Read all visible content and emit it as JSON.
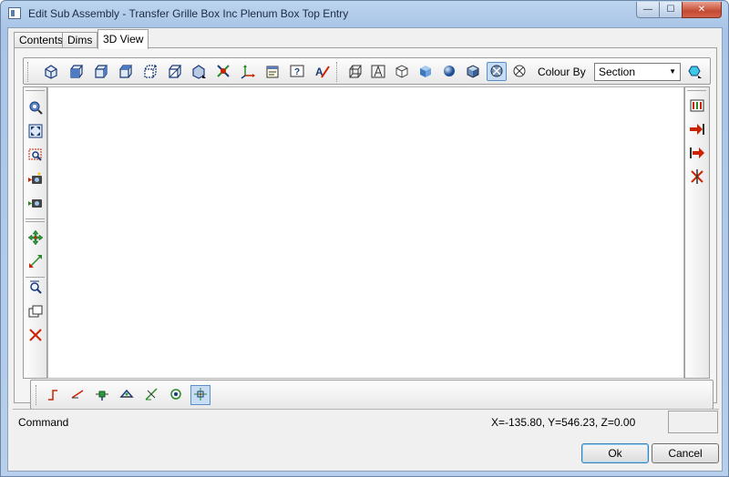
{
  "window": {
    "title": "Edit Sub Assembly - Transfer Grille Box Inc Plenum Box Top Entry",
    "controls": {
      "minimize": "—",
      "maximize": "☐",
      "close": "✕"
    }
  },
  "tabs": [
    {
      "label": "Contents"
    },
    {
      "label": "Dims"
    },
    {
      "label": "3D View"
    }
  ],
  "top_toolbar": {
    "view_icons": [
      "iso-view-icon",
      "front-view-icon",
      "back-view-icon",
      "left-view-icon",
      "right-view-icon",
      "top-view-icon",
      "bottom-view-icon",
      "axis-rotate-icon",
      "ucs-icon",
      "properties-icon",
      "help-icon",
      "text-edit-icon"
    ],
    "render_icons": [
      "wireframe-icon",
      "hidden-line-icon",
      "outline-icon",
      "shaded-icon",
      "sphere-shaded-icon",
      "solid-shaded-icon",
      "section-render-icon",
      "section-clear-icon"
    ],
    "selected_render": "section-render-icon",
    "colour_by_label": "Colour By",
    "colour_by_value": "Section",
    "colour_icon": "colour-palette-icon"
  },
  "left_toolbar": {
    "icons": [
      "zoom-pan-icon",
      "zoom-extents-icon",
      "zoom-window-icon",
      "camera-record-icon",
      "camera-playback-icon",
      "move-icon",
      "scale-icon",
      "zoom-select-icon",
      "copy-icon",
      "delete-icon"
    ]
  },
  "right_toolbar": {
    "icons": [
      "columns-icon",
      "export-red-icon",
      "import-red-icon",
      "cut-icon"
    ]
  },
  "bottom_toolbar": {
    "icons": [
      "snap-endpoint-icon",
      "snap-line-icon",
      "snap-midpoint-icon",
      "snap-center-icon",
      "snap-intersect-icon",
      "snap-node-icon",
      "snap-grid-icon"
    ],
    "selected": "snap-grid-icon"
  },
  "status": {
    "command_label": "Command",
    "coordinates": "X=-135.80, Y=546.23, Z=0.00"
  },
  "buttons": {
    "ok": "Ok",
    "cancel": "Cancel"
  },
  "colors": {
    "selected_bg": "#c7ddf4",
    "selected_border": "#5a8fc7",
    "accent_red": "#cc2200",
    "accent_blue": "#1a3a78"
  }
}
